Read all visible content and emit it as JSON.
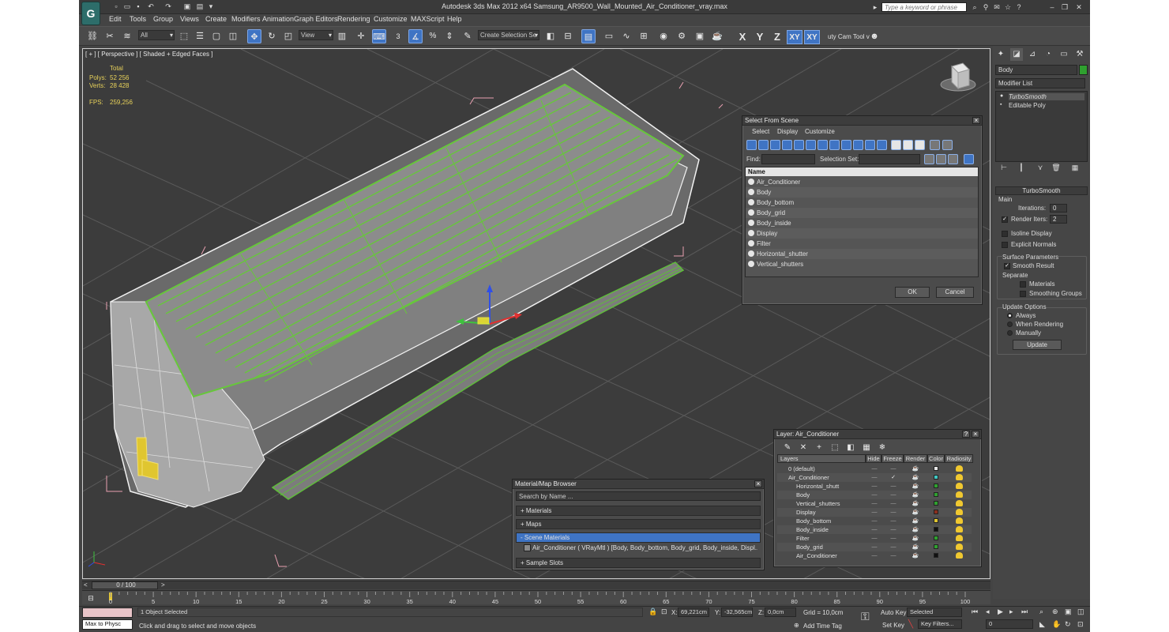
{
  "app": {
    "logo": "G",
    "title": "Autodesk 3ds Max  2012 x64      Samsung_AR9500_Wall_Mounted_Air_Conditioner_vray.max",
    "search_placeholder": "Type a keyword or phrase"
  },
  "menu": [
    "Edit",
    "Tools",
    "Group",
    "Views",
    "Create",
    "Modifiers",
    "Animation",
    "Graph Editors",
    "Rendering",
    "Customize",
    "MAXScript",
    "Help"
  ],
  "toolbar": {
    "filter_value": "All",
    "refcoord_value": "View",
    "selection_set_value": "Create Selection Se",
    "snap_label": "3",
    "angle_label": "%",
    "axis_x": "X",
    "axis_y": "Y",
    "axis_z": "Z",
    "axis_xy": "XY",
    "axis_xy2": "XY",
    "cam_tool": "uty Cam Tool v"
  },
  "viewport": {
    "label": "[ + ] [ Perspective ] [ Shaded + Edged Faces ]",
    "stats": {
      "total_label": "Total",
      "polys_label": "Polys:",
      "polys_value": "52 256",
      "verts_label": "Verts:",
      "verts_value": "28 428",
      "fps_label": "FPS:",
      "fps_value": "259,256"
    }
  },
  "select_from_scene": {
    "title": "Select From Scene",
    "menu": [
      "Select",
      "Display",
      "Customize"
    ],
    "find_label": "Find:",
    "selection_set_label": "Selection Set:",
    "column_name": "Name",
    "items": [
      "Air_Conditioner",
      "Body",
      "Body_bottom",
      "Body_grid",
      "Body_inside",
      "Display",
      "Filter",
      "Horizontal_shutter",
      "Vertical_shutters"
    ],
    "ok": "OK",
    "cancel": "Cancel"
  },
  "material_browser": {
    "title": "Material/Map Browser",
    "search_placeholder": "Search by Name ...",
    "sections": [
      "+ Materials",
      "+ Maps",
      "- Scene Materials"
    ],
    "scene_item": "Air_Conditioner ( VRayMtl ) [Body, Body_bottom, Body_grid, Body_inside, Displ...",
    "sample_slots": "+ Sample Slots"
  },
  "layer_manager": {
    "title": "Layer: Air_Conditioner",
    "help": "?",
    "columns": [
      "Layers",
      "Hide",
      "Freeze",
      "Render",
      "Color",
      "Radiosity"
    ],
    "rows": [
      {
        "name": "0 (default)",
        "color": "#e8e8e8"
      },
      {
        "name": "Air_Conditioner",
        "color": "#3fc6c2"
      },
      {
        "name": "Horizontal_shutt",
        "color": "#2fa02f"
      },
      {
        "name": "Body",
        "color": "#2fa02f"
      },
      {
        "name": "Vertical_shutters",
        "color": "#2fa02f"
      },
      {
        "name": "Display",
        "color": "#8a2e1e"
      },
      {
        "name": "Body_bottom",
        "color": "#e0c630"
      },
      {
        "name": "Body_inside",
        "color": "#111111"
      },
      {
        "name": "Filter",
        "color": "#2fa02f"
      },
      {
        "name": "Body_grid",
        "color": "#2fa02f"
      },
      {
        "name": "Air_Conditioner",
        "color": "#111111"
      }
    ],
    "check": "✓"
  },
  "command_panel": {
    "object_name": "Body",
    "object_color": "#2fa02f",
    "modifier_list": "Modifier List",
    "stack": [
      "TurboSmooth",
      "Editable Poly"
    ],
    "rollout_title": "TurboSmooth",
    "main_label": "Main",
    "iterations_label": "Iterations:",
    "iterations_value": "0",
    "render_iters_label": "Render Iters:",
    "render_iters_value": "2",
    "isoline_label": "Isoline Display",
    "explicit_normals_label": "Explicit Normals",
    "surface_params_label": "Surface Parameters",
    "smooth_result_label": "Smooth Result",
    "separate_label": "Separate",
    "materials_label": "Materials",
    "smoothing_groups_label": "Smoothing Groups",
    "update_options_label": "Update Options",
    "always_label": "Always",
    "when_rendering_label": "When Rendering",
    "manually_label": "Manually",
    "update_button": "Update"
  },
  "timeline": {
    "frame_range": "0 / 100",
    "ticks": [
      "0",
      "5",
      "10",
      "15",
      "20",
      "25",
      "30",
      "35",
      "40",
      "45",
      "50",
      "55",
      "60",
      "65",
      "70",
      "75",
      "80",
      "85",
      "90",
      "95",
      "100"
    ]
  },
  "status": {
    "maxscript": "Max to Physc",
    "selected_text": "1 Object Selected",
    "prompt_text": "Click and drag to select and move objects",
    "x_label": "X:",
    "x_value": "69,221cm",
    "y_label": "Y:",
    "y_value": "-32,565cm",
    "z_label": "Z:",
    "z_value": "0,0cm",
    "grid_text": "Grid = 10,0cm",
    "add_time_tag": "Add Time Tag",
    "auto_key": "Auto Key",
    "set_key": "Set Key",
    "selected_dd": "Selected",
    "key_filters": "Key Filters...",
    "frame_value": "0"
  }
}
